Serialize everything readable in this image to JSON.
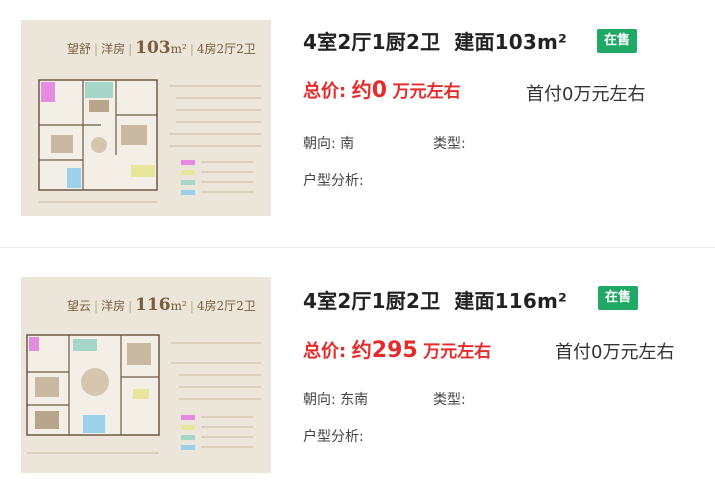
{
  "listings": [
    {
      "thumb": {
        "name": "望舒",
        "style": "洋房",
        "area_label": "103",
        "unit": "m²",
        "rooms": "4房2厅2卫"
      },
      "title": {
        "layout": "4室2厅1厨2卫",
        "area": "建面103m²"
      },
      "status": "在售",
      "price": {
        "label": "总价:",
        "about": "约",
        "value": "0",
        "unit": "万元左右"
      },
      "down_payment": "首付0万元左右",
      "orientation": {
        "label": "朝向:",
        "value": "南"
      },
      "type": {
        "label": "类型:",
        "value": ""
      },
      "analysis": {
        "label": "户型分析:",
        "value": ""
      }
    },
    {
      "thumb": {
        "name": "望云",
        "style": "洋房",
        "area_label": "116",
        "unit": "m²",
        "rooms": "4房2厅2卫"
      },
      "title": {
        "layout": "4室2厅1厨2卫",
        "area": "建面116m²"
      },
      "status": "在售",
      "price": {
        "label": "总价:",
        "about": "约",
        "value": "295",
        "unit": "万元左右"
      },
      "down_payment": "首付0万元左右",
      "orientation": {
        "label": "朝向:",
        "value": "东南"
      },
      "type": {
        "label": "类型:",
        "value": ""
      },
      "analysis": {
        "label": "户型分析:",
        "value": ""
      }
    }
  ],
  "colors": {
    "price_red": "#e52c2c",
    "badge_green": "#20a867",
    "thumb_bg": "#ece6da",
    "thumb_text": "#7a5e3a"
  }
}
